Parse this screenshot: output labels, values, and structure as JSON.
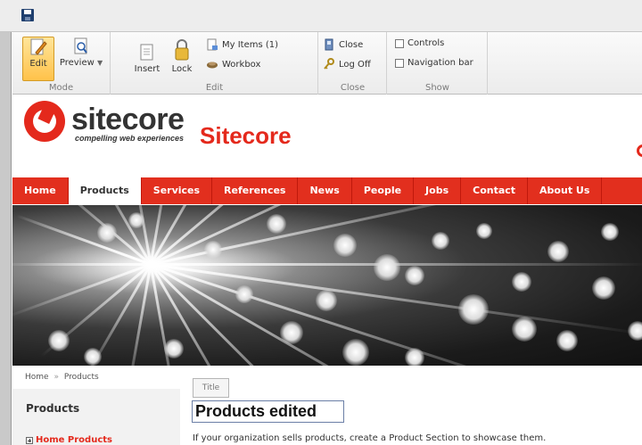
{
  "ribbon": {
    "mode": {
      "label": "Mode",
      "edit": "Edit",
      "preview": "Preview"
    },
    "edit": {
      "label": "Edit",
      "insert": "Insert",
      "lock": "Lock",
      "my_items": "My Items (1)",
      "workbox": "Workbox"
    },
    "close": {
      "label": "Close",
      "close": "Close",
      "log_off": "Log Off"
    },
    "show": {
      "label": "Show",
      "controls": "Controls",
      "navigation_bar": "Navigation bar"
    }
  },
  "site": {
    "logo_word": "sitecore",
    "logo_tagline": "compelling web experiences",
    "title": "Sitecore"
  },
  "nav": [
    "Home",
    "Products",
    "Services",
    "References",
    "News",
    "People",
    "Jobs",
    "Contact",
    "About Us"
  ],
  "nav_active": "Products",
  "breadcrumb": {
    "home": "Home",
    "sep": "»",
    "current": "Products"
  },
  "sidebar": {
    "title": "Products",
    "link": "Home Products"
  },
  "content": {
    "field_tag": "Title",
    "heading": "Products edited",
    "body": "If your organization sells products, create a Product Section to showcase them."
  },
  "colors": {
    "brand_red": "#e22f1e",
    "edit_highlight": "#ffc24a"
  },
  "icons": [
    "save-icon",
    "edit-icon",
    "preview-icon",
    "insert-icon",
    "lock-icon",
    "my-items-icon",
    "workbox-icon",
    "close-icon",
    "log-off-icon"
  ]
}
